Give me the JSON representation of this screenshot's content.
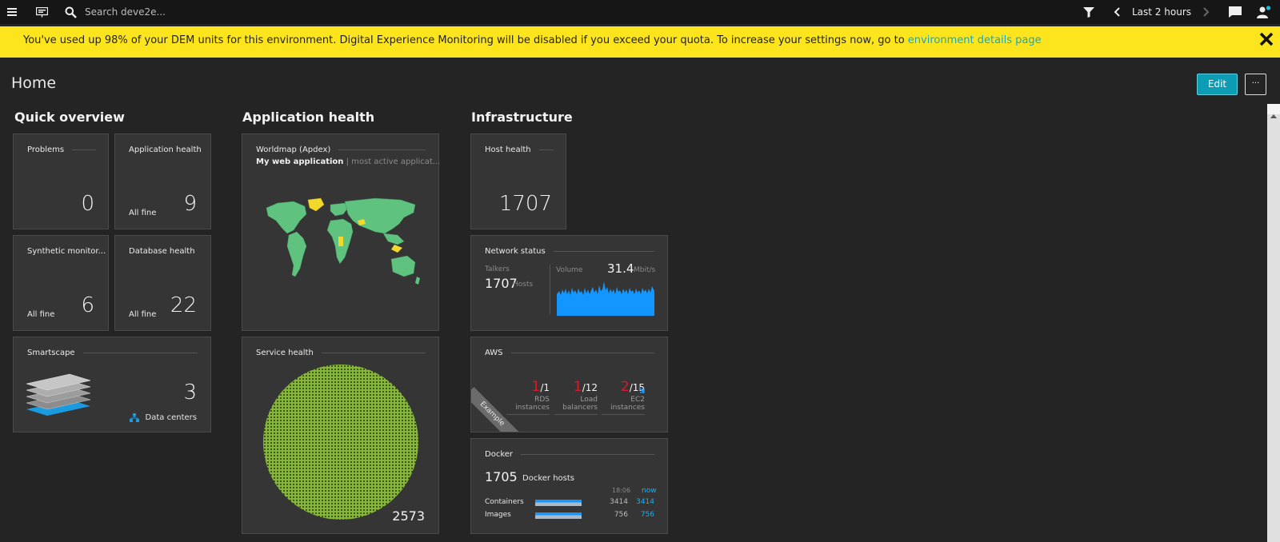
{
  "topbar": {
    "search_placeholder": "Search deve2e...",
    "timeframe": "Last 2 hours"
  },
  "banner": {
    "message": "You've used up 98% of your DEM units for this environment. Digital Experience Monitoring will be disabled if you exceed your quota. To increase your settings now, go to ",
    "link": "environment details page"
  },
  "page": {
    "title": "Home",
    "edit_label": "Edit",
    "more_label": "···"
  },
  "sections": {
    "quick": "Quick overview",
    "app": "Application health",
    "infra": "Infrastructure"
  },
  "tiles": {
    "problems": {
      "title": "Problems",
      "value": "0"
    },
    "app_health": {
      "title": "Application health",
      "status": "All fine",
      "value": "9"
    },
    "synthetic": {
      "title": "Synthetic monitor...",
      "status": "All fine",
      "value": "6"
    },
    "db_health": {
      "title": "Database health",
      "status": "All fine",
      "value": "22"
    },
    "smartscape": {
      "title": "Smartscape",
      "value": "3",
      "label": "Data centers"
    },
    "worldmap": {
      "title": "Worldmap (Apdex)",
      "app": "My web application",
      "sep": " | ",
      "suffix": "most active applicat..."
    },
    "service": {
      "title": "Service health",
      "value": "2573"
    },
    "host": {
      "title": "Host health",
      "value": "1707"
    },
    "network": {
      "title": "Network status",
      "talkers_label": "Talkers",
      "talkers_value": "1707",
      "talkers_unit": "Hosts",
      "volume_label": "Volume",
      "volume_value": "31.4",
      "volume_unit": "Mbit/s"
    },
    "aws": {
      "title": "AWS",
      "ribbon": "Example",
      "items": [
        {
          "num": "1",
          "den": "/1",
          "l1": "RDS",
          "l2": "instances"
        },
        {
          "num": "1",
          "den": "/12",
          "l1": "Load",
          "l2": "balancers"
        },
        {
          "num": "2",
          "den": "/15",
          "l1": "EC2",
          "l2": "instances"
        }
      ]
    },
    "docker": {
      "title": "Docker",
      "hosts_value": "1705",
      "hosts_label": "Docker hosts",
      "col_then": "18:06",
      "col_now": "now",
      "rows": [
        {
          "label": "Containers",
          "then": "3414",
          "now": "3414"
        },
        {
          "label": "Images",
          "then": "756",
          "now": "756"
        }
      ]
    }
  },
  "colors": {
    "accent": "#0c9db5",
    "banner": "#fde51d",
    "healthy": "#5fc27e",
    "warning": "#f1d82b",
    "error": "#dc172a",
    "chart": "#1496ff"
  }
}
